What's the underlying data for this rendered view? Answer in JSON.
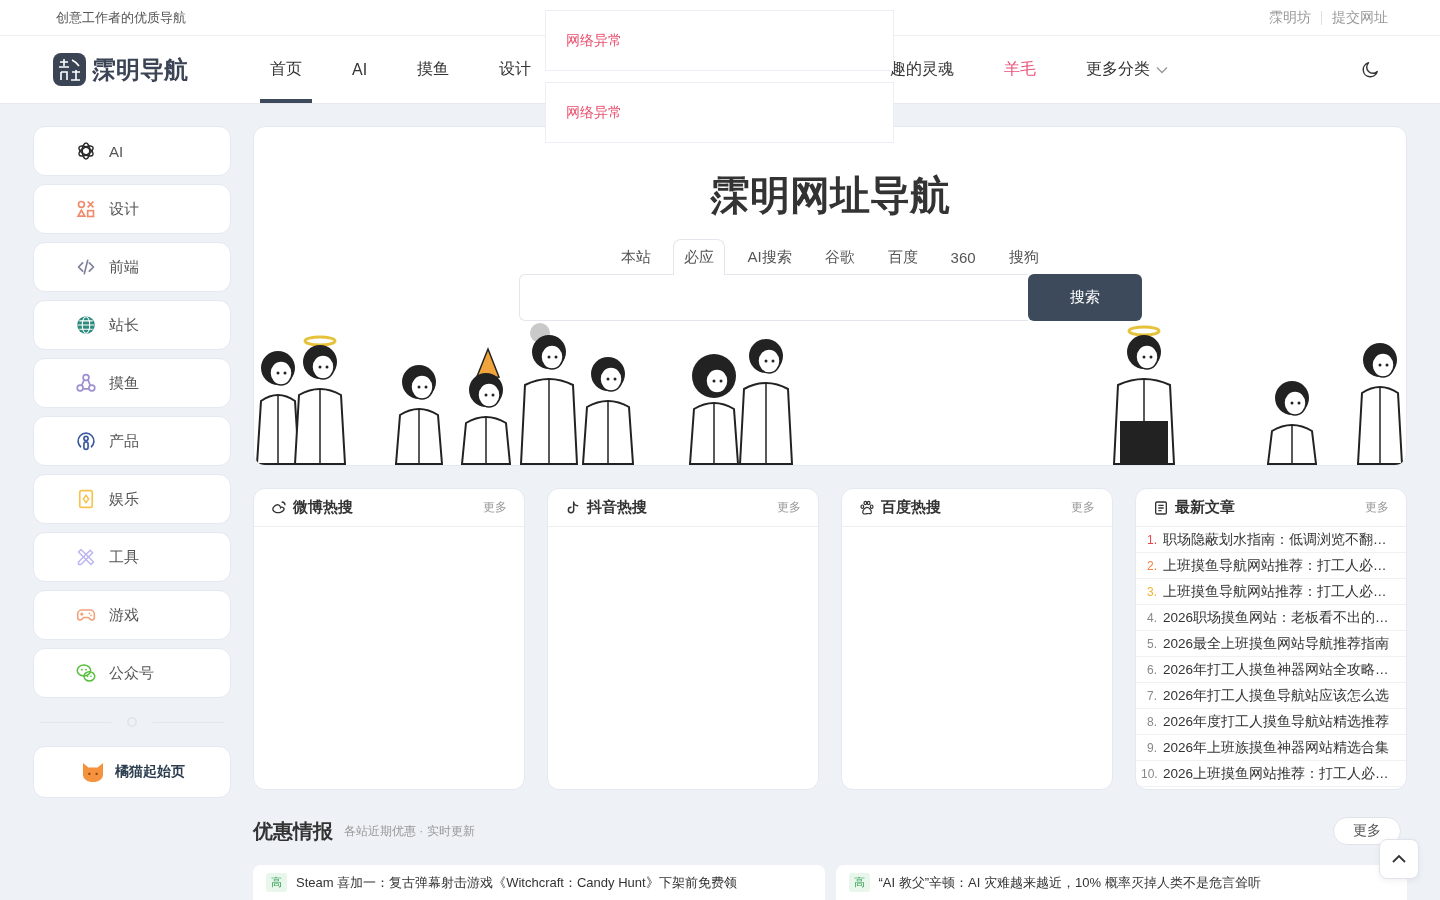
{
  "top_bar": {
    "tagline": "创意工作者的优质导航",
    "links": [
      "霂明坊",
      "提交网址"
    ]
  },
  "header": {
    "brand": "霂明导航",
    "nav": [
      {
        "label": "首页",
        "kind": "link",
        "selected": true,
        "color": "#333333"
      },
      {
        "label": "AI",
        "kind": "link",
        "selected": false,
        "color": "#333333"
      },
      {
        "label": "摸鱼",
        "kind": "link",
        "selected": false,
        "color": "#333333"
      },
      {
        "label": "设计",
        "kind": "link",
        "selected": false,
        "color": "#333333"
      },
      {
        "label": "趣的灵魂",
        "kind": "link",
        "selected": false,
        "color": "#333333"
      },
      {
        "label": "羊毛",
        "kind": "link",
        "selected": false,
        "color": "#e8517a"
      },
      {
        "label": "更多分类",
        "kind": "dropdown",
        "selected": false,
        "color": "#333333"
      }
    ]
  },
  "toasts": [
    {
      "text": "网络异常"
    },
    {
      "text": "网络异常"
    }
  ],
  "sidebar": {
    "items": [
      {
        "label": "AI"
      },
      {
        "label": "设计"
      },
      {
        "label": "前端"
      },
      {
        "label": "站长"
      },
      {
        "label": "摸鱼"
      },
      {
        "label": "产品"
      },
      {
        "label": "娱乐"
      },
      {
        "label": "工具"
      },
      {
        "label": "游戏"
      },
      {
        "label": "公众号"
      }
    ],
    "featured": {
      "label": "橘猫起始页"
    }
  },
  "hero": {
    "title": "霂明网址导航",
    "search_tabs": [
      {
        "label": "本站",
        "selected": false
      },
      {
        "label": "必应",
        "selected": true
      },
      {
        "label": "AI搜索",
        "selected": false
      },
      {
        "label": "谷歌",
        "selected": false
      },
      {
        "label": "百度",
        "selected": false
      },
      {
        "label": "360",
        "selected": false
      },
      {
        "label": "搜狗",
        "selected": false
      }
    ],
    "search_button": "搜索"
  },
  "panels": [
    {
      "kind": "hot",
      "title": "微博热搜",
      "more": "更多"
    },
    {
      "kind": "hot",
      "title": "抖音热搜",
      "more": "更多"
    },
    {
      "kind": "hot",
      "title": "百度热搜",
      "more": "更多"
    },
    {
      "kind": "articles",
      "title": "最新文章",
      "more": "更多",
      "items": [
        {
          "rank": "1.",
          "title": "职场隐蔽划水指南：低调浏览不翻…",
          "color": "#e5484d"
        },
        {
          "rank": "2.",
          "title": "上班摸鱼导航网站推荐：打工人必…",
          "color": "#f0803c"
        },
        {
          "rank": "3.",
          "title": "上班摸鱼导航网站推荐：打工人必…",
          "color": "#f2b233"
        },
        {
          "rank": "4.",
          "title": "2026职场摸鱼网站：老板看不出的…",
          "color": "#888888"
        },
        {
          "rank": "5.",
          "title": "2026最全上班摸鱼网站导航推荐指南",
          "color": "#888888"
        },
        {
          "rank": "6.",
          "title": "2026年打工人摸鱼神器网站全攻略…",
          "color": "#888888"
        },
        {
          "rank": "7.",
          "title": "2026年打工人摸鱼导航站应该怎么选",
          "color": "#888888"
        },
        {
          "rank": "8.",
          "title": "2026年度打工人摸鱼导航站精选推荐",
          "color": "#888888"
        },
        {
          "rank": "9.",
          "title": "2026年上班族摸鱼神器网站精选合集",
          "color": "#888888"
        },
        {
          "rank": "10.",
          "title": "2026上班摸鱼网站推荐：打工人必…",
          "color": "#888888"
        }
      ]
    }
  ],
  "deals": {
    "title": "优惠情报",
    "subtitle": "各站近期优惠 · 实时更新",
    "more": "更多",
    "items": [
      {
        "badge": "高",
        "text": "Steam 喜加一：复古弹幕射击游戏《Witchcraft：Candy Hunt》下架前免费领"
      },
      {
        "badge": "高",
        "text": "“AI 教父”辛顿：AI 灾难越来越近，10% 概率灭掉人类不是危言耸听"
      }
    ]
  }
}
